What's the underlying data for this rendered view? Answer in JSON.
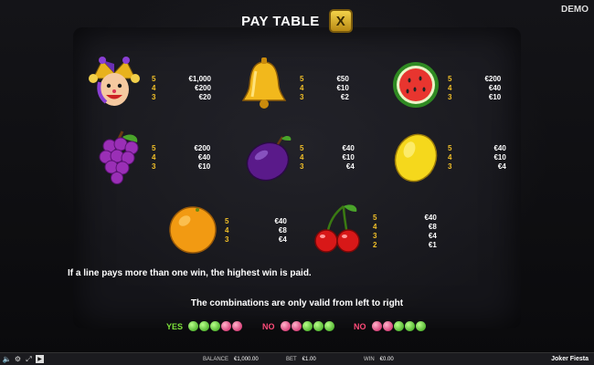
{
  "demo_label": "DEMO",
  "header": {
    "title": "PAY TABLE",
    "close_label": "X"
  },
  "paytable": [
    {
      "symbol": "joker",
      "counts": [
        "5",
        "4",
        "3"
      ],
      "values": [
        "€1,000",
        "€200",
        "€20"
      ]
    },
    {
      "symbol": "bell",
      "counts": [
        "5",
        "4",
        "3"
      ],
      "values": [
        "€50",
        "€10",
        "€2"
      ]
    },
    {
      "symbol": "watermelon",
      "counts": [
        "5",
        "4",
        "3"
      ],
      "values": [
        "€200",
        "€40",
        "€10"
      ]
    },
    {
      "symbol": "grapes",
      "counts": [
        "5",
        "4",
        "3"
      ],
      "values": [
        "€200",
        "€40",
        "€10"
      ]
    },
    {
      "symbol": "plum",
      "counts": [
        "5",
        "4",
        "3"
      ],
      "values": [
        "€40",
        "€10",
        "€4"
      ]
    },
    {
      "symbol": "lemon",
      "counts": [
        "5",
        "4",
        "3"
      ],
      "values": [
        "€40",
        "€10",
        "€4"
      ]
    },
    {
      "symbol": "orange",
      "counts": [
        "5",
        "4",
        "3"
      ],
      "values": [
        "€40",
        "€8",
        "€4"
      ]
    },
    {
      "symbol": "cherries",
      "counts": [
        "5",
        "4",
        "3",
        "2"
      ],
      "values": [
        "€40",
        "€8",
        "€4",
        "€1"
      ]
    }
  ],
  "note": "If a line pays more than one win, the highest win is paid.",
  "combinations": {
    "title": "The combinations are only valid from left to right",
    "items": [
      {
        "label": "YES",
        "dots": [
          "g",
          "g",
          "g",
          "p",
          "p"
        ]
      },
      {
        "label": "NO",
        "dots": [
          "p",
          "g",
          "g",
          "g",
          "p"
        ]
      },
      {
        "label": "NO",
        "dots": [
          "p",
          "p",
          "g",
          "g",
          "g"
        ]
      }
    ]
  },
  "bottom_bar": {
    "balance_label": "BALANCE",
    "balance_value": "€1,000.00",
    "bet_label": "BET",
    "bet_value": "€1.00",
    "win_label": "WIN",
    "win_value": "€0.00",
    "game_name": "Joker Fiesta"
  },
  "icons": [
    "sound-icon",
    "settings-icon",
    "fullscreen-icon",
    "play-icon"
  ]
}
